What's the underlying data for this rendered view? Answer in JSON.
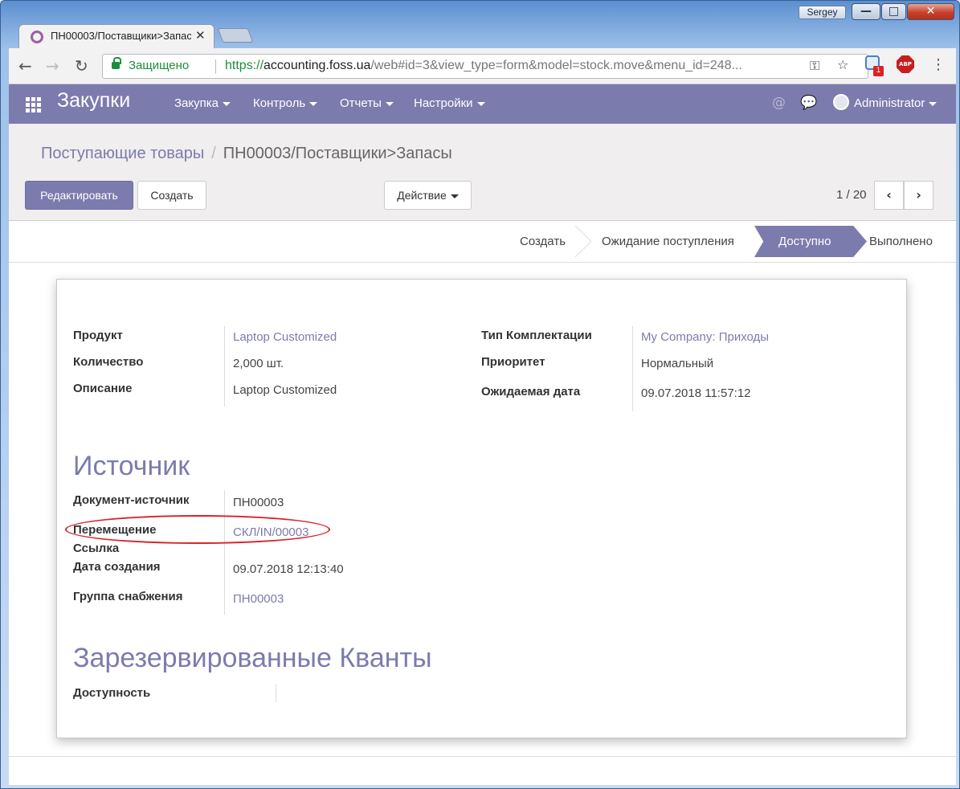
{
  "browser": {
    "user": "Sergey",
    "tab_title": "ПН00003/Поставщики>Запасы",
    "tab_close": "✕",
    "secure_label": "Защищено",
    "url_scheme": "https://",
    "url_host": "accounting.foss.ua",
    "url_path": "/web#id=3&view_type=form&model=stock.move&menu_id=248...",
    "ext_badge": "1",
    "abp_label": "ABP"
  },
  "app": {
    "title": "Закупки",
    "menu": [
      "Закупка",
      "Контроль",
      "Отчеты",
      "Настройки"
    ],
    "user": "Administrator"
  },
  "breadcrumb": {
    "parent": "Поступающие товары",
    "separator": "/",
    "current": "ПН00003/Поставщики>Запасы"
  },
  "toolbar": {
    "edit_label": "Редактировать",
    "create_label": "Создать",
    "action_label": "Действие",
    "pager": "1 / 20"
  },
  "statusbar": {
    "steps": [
      "Создать",
      "Ожидание поступления",
      "Доступно",
      "Выполнено"
    ],
    "active": "Доступно"
  },
  "form": {
    "left_fields": [
      {
        "label": "Продукт",
        "value": "Laptop Customized",
        "link": true
      },
      {
        "label": "Количество",
        "value": "2,000 шт.",
        "link": false
      },
      {
        "label": "Описание",
        "value": "Laptop Customized",
        "link": false
      }
    ],
    "right_fields": [
      {
        "label": "Тип Комплектации",
        "value": "My Company: Приходы",
        "link": true
      },
      {
        "label": "Приоритет",
        "value": "Нормальный",
        "link": false
      },
      {
        "label": "Ожидаемая дата",
        "value": "09.07.2018 11:57:12",
        "link": false
      }
    ],
    "source_title": "Источник",
    "source_fields": [
      {
        "label": "Документ-источник",
        "value": "ПН00003",
        "link": false
      },
      {
        "label": "Перемещение",
        "value": "СКЛ/IN/00003",
        "link": true
      },
      {
        "label": "Ссылка",
        "value": "",
        "link": false
      },
      {
        "label": "Дата создания",
        "value": "09.07.2018 12:13:40",
        "link": false
      },
      {
        "label": "Группа снабжения",
        "value": "ПН00003",
        "link": true
      }
    ],
    "quants_title": "Зарезервированные Кванты",
    "quants_fields": [
      {
        "label": "Доступность",
        "value": ""
      }
    ]
  },
  "colors": {
    "brand": "#7c7bad",
    "highlight": "#d8232a"
  }
}
